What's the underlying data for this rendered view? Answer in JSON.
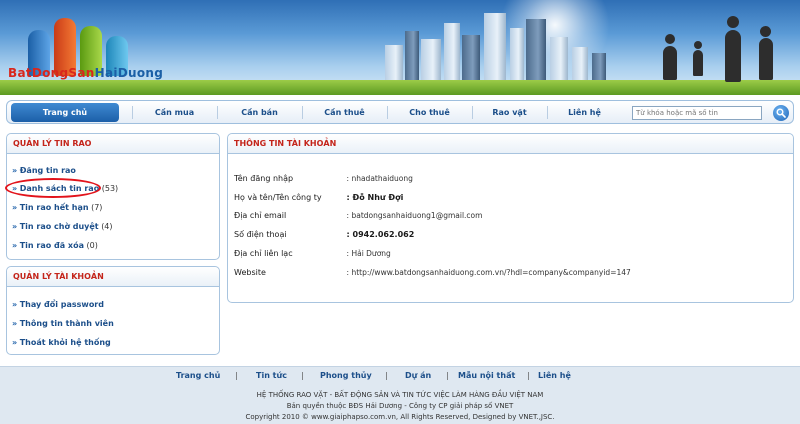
{
  "header": {
    "logo_part1": "BatDongSan",
    "logo_part2": "HaiDuong"
  },
  "nav": {
    "tabs": [
      {
        "label": "Trang chủ",
        "active": true
      },
      {
        "label": "Cần mua"
      },
      {
        "label": "Cần bán"
      },
      {
        "label": "Cần thuê"
      },
      {
        "label": "Cho thuê"
      },
      {
        "label": "Rao vặt"
      },
      {
        "label": "Liên hệ"
      }
    ],
    "search_placeholder": "Từ khóa hoặc mã số tin"
  },
  "listings_panel": {
    "title": "QUẢN LÝ TIN RAO",
    "items": [
      {
        "label": "Đăng tin rao",
        "count": ""
      },
      {
        "label": "Danh sách tin rao",
        "count": "(53)"
      },
      {
        "label": "Tin rao hết hạn",
        "count": "(7)"
      },
      {
        "label": "Tin rao chờ duyệt",
        "count": "(4)"
      },
      {
        "label": "Tin rao đã xóa",
        "count": "(0)"
      }
    ]
  },
  "account_panel": {
    "title": "QUẢN LÝ TÀI KHOẢN",
    "items": [
      {
        "label": "Thay đổi password"
      },
      {
        "label": "Thông tin thành viên"
      },
      {
        "label": "Thoát khỏi hệ thống"
      }
    ]
  },
  "account_info": {
    "title": "THÔNG TIN TÀI KHOẢN",
    "rows": [
      {
        "key": "Tên đăng nhập",
        "value": ": nhadathaiduong"
      },
      {
        "key": "Họ và tên/Tên công ty",
        "value": ": Đỗ Như Đợi"
      },
      {
        "key": "Địa chỉ email",
        "value": ": batdongsanhaiduong1@gmail.com"
      },
      {
        "key": "Số điện thoại",
        "value": ": 0942.062.062"
      },
      {
        "key": "Địa chỉ liên lạc",
        "value": ": Hải Dương"
      },
      {
        "key": "Website",
        "value": ": http://www.batdongsanhaiduong.com.vn/?hdl=company&companyid=147"
      }
    ]
  },
  "footer": {
    "links": [
      "Trang chủ",
      "Tin tức",
      "Phong thủy",
      "Dự án",
      "Mẫu nội thất",
      "Liên hệ"
    ],
    "line1": "HỆ THỐNG RAO VẶT - BẤT ĐỘNG SẢN VÀ TIN TỨC VIỆC LÀM HÀNG ĐẦU VIỆT NAM",
    "line2": "Bản quyền thuộc BĐS Hải Dương - Công ty CP giải pháp số VNET",
    "line3": "Copyright 2010 © www.giaiphapso.com.vn, All Rights Reserved, Designed by VNET.,JSC."
  },
  "colors": {
    "accent_blue": "#1c5fa8",
    "heading_red": "#c4251b",
    "highlight_circle": "#e2131b"
  }
}
